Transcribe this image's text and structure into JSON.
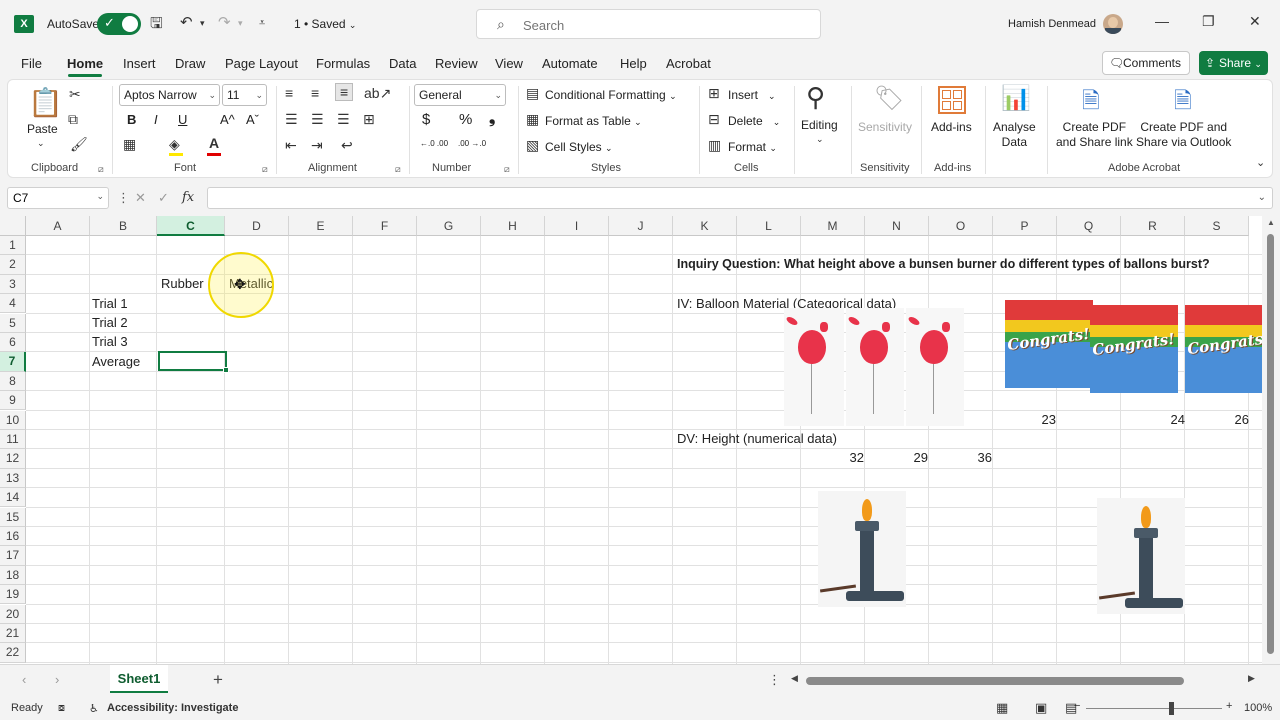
{
  "titlebar": {
    "app_logo": "X",
    "autosave_label": "AutoSave",
    "file_status": "1 • Saved",
    "search_placeholder": "Search",
    "user_name": "Hamish Denmead",
    "icons": [
      "save-icon",
      "undo-icon",
      "redo-icon",
      "customize-icon",
      "minimize-icon",
      "restore-icon",
      "close-icon"
    ]
  },
  "menu": {
    "tabs": [
      "File",
      "Home",
      "Insert",
      "Draw",
      "Page Layout",
      "Formulas",
      "Data",
      "Review",
      "View",
      "Automate",
      "Help",
      "Acrobat"
    ],
    "active_tab": "Home",
    "comments_label": "Comments",
    "share_label": "Share"
  },
  "ribbon": {
    "clipboard": {
      "paste": "Paste",
      "label": "Clipboard"
    },
    "font": {
      "name": "Aptos Narrow",
      "size": "11",
      "label": "Font",
      "bold": "B",
      "italic": "I",
      "underline": "U",
      "grow": "A^",
      "shrink": "Aˇ"
    },
    "alignment": {
      "label": "Alignment"
    },
    "number": {
      "format": "General",
      "label": "Number",
      "currency": "$",
      "percent": "%",
      "comma": "❟",
      "inc_decimal": "←.0 .00",
      "dec_decimal": ".00 →.0"
    },
    "styles": {
      "conditional": "Conditional Formatting",
      "format_table": "Format as Table",
      "cell_styles": "Cell Styles",
      "label": "Styles"
    },
    "cells": {
      "insert": "Insert",
      "delete": "Delete",
      "format": "Format",
      "label": "Cells"
    },
    "editing": {
      "label": "Editing"
    },
    "sensitivity": {
      "button": "Sensitivity",
      "label": "Sensitivity"
    },
    "addins": {
      "button": "Add-ins",
      "label": "Add-ins"
    },
    "analyse": {
      "line1": "Analyse",
      "line2": "Data"
    },
    "acrobat": {
      "pdf1_line1": "Create PDF",
      "pdf1_line2": "and Share link",
      "pdf2_line1": "Create PDF and",
      "pdf2_line2": "Share via Outlook",
      "label": "Adobe Acrobat"
    }
  },
  "formula_bar": {
    "name_box": "C7",
    "formula": "",
    "fx": "fx"
  },
  "grid": {
    "columns": [
      "A",
      "B",
      "C",
      "D",
      "E",
      "F",
      "G",
      "H",
      "I",
      "J",
      "K",
      "L",
      "M",
      "N",
      "O",
      "P",
      "Q",
      "R",
      "S"
    ],
    "rows": [
      "1",
      "2",
      "3",
      "4",
      "5",
      "6",
      "7",
      "8",
      "9",
      "10",
      "11",
      "12",
      "13",
      "14",
      "15",
      "16",
      "17",
      "18",
      "19",
      "20",
      "21",
      "22"
    ],
    "selected_col": "C",
    "selected_row": "7",
    "cells": {
      "C3": "Rubber",
      "D3": "Metallic",
      "B4": "Trial 1",
      "B5": "Trial 2",
      "B6": "Trial 3",
      "B7": "Average",
      "K2": "Inquiry Question: What height above a bunsen burner do different types of ballons burst?",
      "K4": "IV: Balloon Material  (Categorical data)",
      "P10": "23",
      "R10": "24",
      "S10": "26",
      "K11": "DV: Height (numerical data)",
      "M12": "32",
      "N12": "29",
      "O12": "36"
    },
    "balloon_image_text": "Congrats!"
  },
  "sheets": {
    "tabs": [
      "Sheet1"
    ],
    "active": "Sheet1"
  },
  "statusbar": {
    "ready": "Ready",
    "accessibility": "Accessibility: Investigate",
    "zoom": "100%"
  },
  "colors": {
    "accent": "#107c41",
    "balloon_red": "#e8334a"
  }
}
